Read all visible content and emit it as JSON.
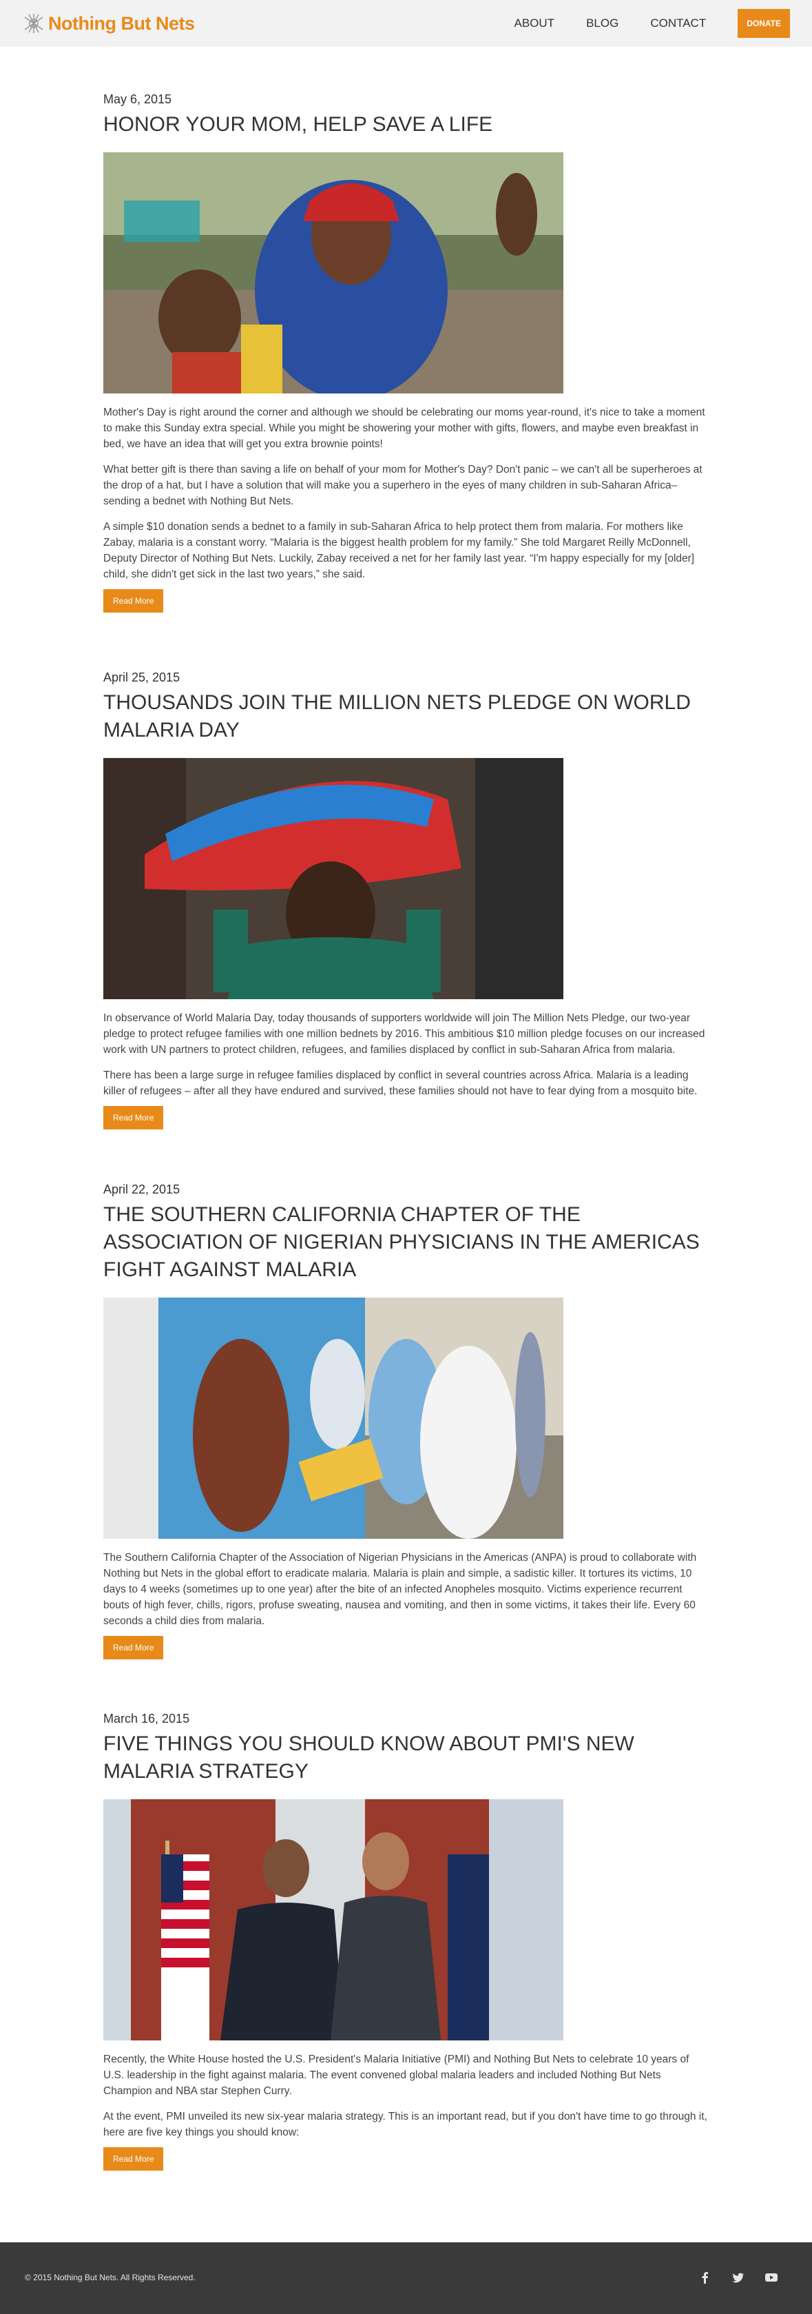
{
  "header": {
    "logo_text": "Nothing But Nets",
    "nav": {
      "about": "ABOUT",
      "blog": "BLOG",
      "contact": "CONTACT",
      "donate": "DONATE"
    }
  },
  "colors": {
    "brand_orange": "#e88a1a",
    "header_bg": "#f2f2f2",
    "footer_bg": "#3a3a3a"
  },
  "posts": [
    {
      "date": "May 6, 2015",
      "title": "HONOR YOUR MOM, HELP SAVE A LIFE",
      "paragraphs": [
        "Mother's Day is right around the corner and although we should be celebrating our moms year-round, it's nice to take a moment to make this Sunday extra special. While you might be showering your mother with gifts, flowers, and maybe even breakfast in bed, we have an idea that will get you extra brownie points!",
        "What better gift is there than saving a life on behalf of your mom for Mother's Day? Don't panic – we can't all be superheroes at the drop of a hat, but I have a solution that will make you a superhero in the eyes of many children in sub-Saharan Africa–sending a bednet with Nothing But Nets.",
        "A simple $10 donation sends a bednet to a family in sub-Saharan Africa to help protect them from malaria. For mothers like Zabay, malaria is a constant worry. “Malaria is the biggest health problem for my family.” She told Margaret Reilly McDonnell, Deputy Director of Nothing But Nets. Luckily, Zabay received a net for her family last year. “I'm happy especially for my [older] child, she didn't get sick in the last two years,” she said."
      ],
      "read_more": "Read More"
    },
    {
      "date": "April 25, 2015",
      "title": "THOUSANDS JOIN THE MILLION NETS PLEDGE ON WORLD MALARIA DAY",
      "paragraphs": [
        "In observance of World Malaria Day, today thousands of supporters worldwide will join The Million Nets Pledge, our two-year pledge to protect refugee families with one million bednets by 2016. This ambitious $10 million pledge focuses on our increased work with UN partners to protect children, refugees, and families displaced by conflict in sub-Saharan Africa from malaria.",
        "There has been a large surge in refugee families displaced by conflict in several countries across Africa. Malaria is a leading killer of refugees – after all they have endured and survived, these families should not have to fear dying from a mosquito bite."
      ],
      "read_more": "Read More"
    },
    {
      "date": "April 22, 2015",
      "title": "THE SOUTHERN CALIFORNIA CHAPTER OF THE ASSOCIATION OF NIGERIAN PHYSICIANS IN THE AMERICAS FIGHT AGAINST MALARIA",
      "paragraphs": [
        "The Southern California Chapter of the Association of Nigerian Physicians in the Americas (ANPA) is proud to collaborate with Nothing but Nets in the global effort to eradicate malaria. Malaria is plain and simple, a sadistic killer. It tortures its victims, 10 days to 4 weeks (sometimes up to one year) after the bite of an infected Anopheles mosquito. Victims experience recurrent bouts of high fever, chills, rigors, profuse sweating, nausea and vomiting, and then in some victims, it takes their life. Every 60 seconds a child dies from malaria."
      ],
      "read_more": "Read More"
    },
    {
      "date": "March 16, 2015",
      "title": "FIVE THINGS YOU SHOULD KNOW ABOUT PMI'S NEW MALARIA STRATEGY",
      "paragraphs": [
        "Recently, the White House hosted the U.S. President's Malaria Initiative (PMI) and Nothing But Nets to celebrate 10 years of U.S. leadership in the fight against malaria. The event convened global malaria leaders and included Nothing But Nets Champion and NBA star Stephen Curry.",
        "At the event, PMI unveiled its new six-year malaria strategy. This is an important read, but if you don't have time to go through it, here are five key things you should know:"
      ],
      "read_more": "Read More"
    }
  ],
  "footer": {
    "copyright": "© 2015 Nothing But Nets. All Rights Reserved.",
    "social_icons": [
      "facebook-icon",
      "twitter-icon",
      "youtube-icon"
    ]
  }
}
